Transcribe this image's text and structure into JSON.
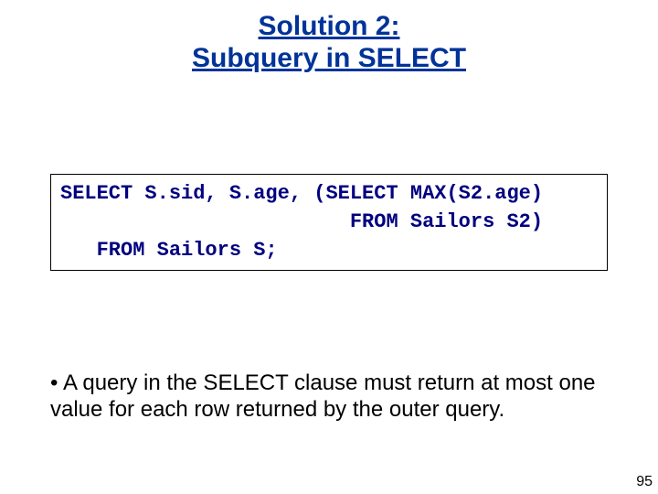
{
  "title": {
    "line1": "Solution 2:",
    "line2": "Subquery in SELECT"
  },
  "code": {
    "line1": "SELECT S.sid, S.age, (SELECT MAX(S2.age)",
    "line2": "                        FROM Sailors S2)",
    "line3": "   FROM Sailors S;"
  },
  "bullet": {
    "marker": "•",
    "text": "A query in the SELECT clause must return at most one value for each row returned by the outer query."
  },
  "page_number": "95"
}
